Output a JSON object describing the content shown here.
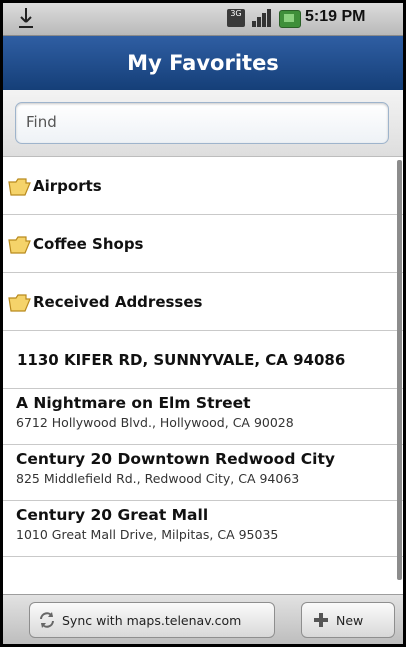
{
  "status_bar": {
    "time": "5:19 PM",
    "network_label": "3G",
    "icons": [
      "usb-icon",
      "3g-icon",
      "signal-bars-icon",
      "battery-icon"
    ]
  },
  "header": {
    "title": "My Favorites"
  },
  "search": {
    "placeholder": "Find",
    "value": ""
  },
  "folders": [
    {
      "label": "Airports"
    },
    {
      "label": "Coffee Shops"
    },
    {
      "label": "Received Addresses"
    }
  ],
  "addresses": [
    {
      "label": "1130 KIFER RD, SUNNYVALE, CA 94086"
    }
  ],
  "places": [
    {
      "name": "A Nightmare on Elm Street",
      "address": "6712 Hollywood Blvd., Hollywood, CA 90028"
    },
    {
      "name": "Century 20 Downtown Redwood City",
      "address": "825 Middlefield Rd., Redwood City, CA 94063"
    },
    {
      "name": "Century 20 Great Mall",
      "address": "1010 Great Mall Drive, Milpitas, CA 95035"
    }
  ],
  "toolbar": {
    "sync_label": "Sync with maps.telenav.com",
    "new_label": "New"
  },
  "colors": {
    "title_bar": "#1f4c8c",
    "folder_icon": "#f2c94c",
    "background": "#ffffff"
  }
}
